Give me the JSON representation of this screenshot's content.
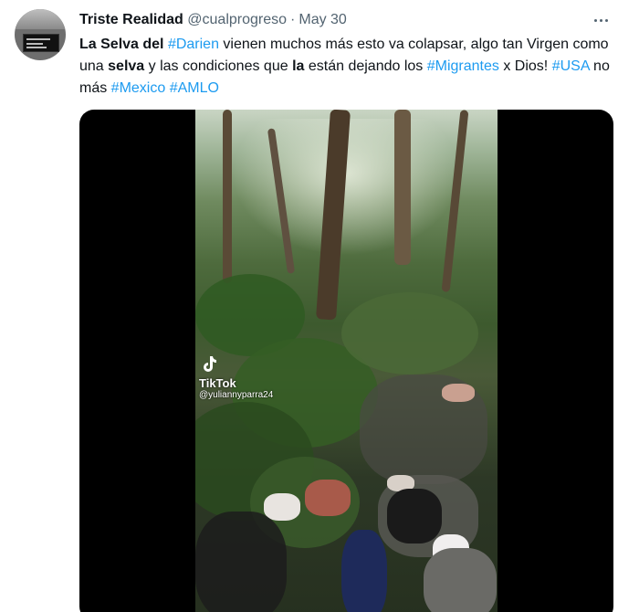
{
  "tweet": {
    "author_name": "Triste Realidad",
    "handle": "@cualprogreso",
    "separator": "·",
    "date": "May 30",
    "text_parts": [
      {
        "kind": "bold",
        "text": "La Selva del "
      },
      {
        "kind": "tag",
        "text": "#Darien"
      },
      {
        "kind": "plain",
        "text": " vienen muchos más esto va colapsar, algo tan Virgen como una "
      },
      {
        "kind": "bold",
        "text": "selva"
      },
      {
        "kind": "plain",
        "text": " y las condiciones que "
      },
      {
        "kind": "bold",
        "text": "la"
      },
      {
        "kind": "plain",
        "text": " están dejando los "
      },
      {
        "kind": "tag",
        "text": "#Migrantes"
      },
      {
        "kind": "plain",
        "text": " x Dios! "
      },
      {
        "kind": "tag",
        "text": "#USA"
      },
      {
        "kind": "plain",
        "text": "  no más "
      },
      {
        "kind": "tag",
        "text": "#Mexico"
      },
      {
        "kind": "plain",
        "text": " "
      },
      {
        "kind": "tag",
        "text": "#AMLO"
      }
    ]
  },
  "media": {
    "watermark_brand": "TikTok",
    "watermark_user": "@yuliannyparra24"
  },
  "icons": {
    "more": "more-horizontal-icon",
    "tiktok": "tiktok-logo-icon"
  },
  "colors": {
    "link": "#1d9bf0",
    "secondary_text": "#536471",
    "media_background": "#000000"
  }
}
